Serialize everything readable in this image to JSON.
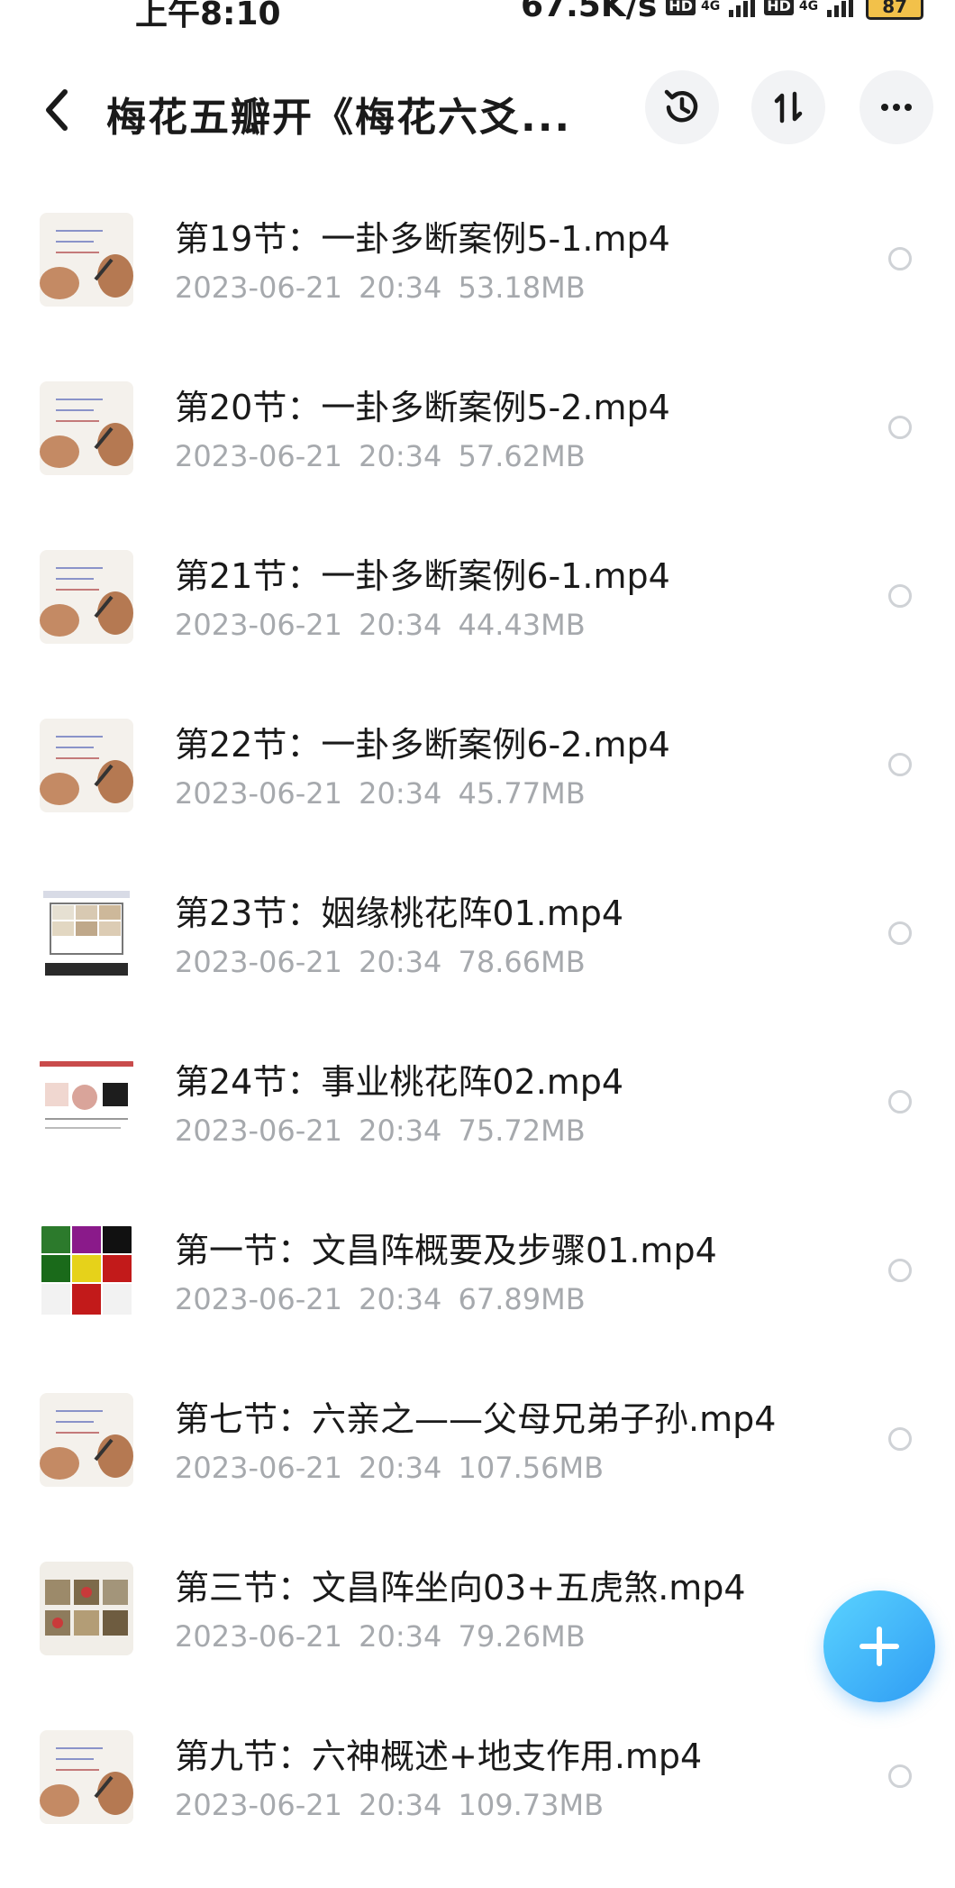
{
  "status_bar": {
    "time": "上午8:10",
    "net_speed": "67.5K/s",
    "sim1_tag": "HD",
    "sim1_type": "4G",
    "sim2_tag": "HD",
    "sim2_type": "4G",
    "battery": "87"
  },
  "header": {
    "title": "梅花五瓣开《梅花六爻...",
    "icons": [
      "back-icon",
      "history-icon",
      "sort-icon",
      "more-icon"
    ]
  },
  "files": [
    {
      "name": "第19节：一卦多断案例5-1.mp4",
      "date": "2023-06-21",
      "time": "20:34",
      "size": "53.18MB",
      "thumb_style": "handwriting"
    },
    {
      "name": "第20节：一卦多断案例5-2.mp4",
      "date": "2023-06-21",
      "time": "20:34",
      "size": "57.62MB",
      "thumb_style": "handwriting"
    },
    {
      "name": "第21节：一卦多断案例6-1.mp4",
      "date": "2023-06-21",
      "time": "20:34",
      "size": "44.43MB",
      "thumb_style": "handwriting"
    },
    {
      "name": "第22节：一卦多断案例6-2.mp4",
      "date": "2023-06-21",
      "time": "20:34",
      "size": "45.77MB",
      "thumb_style": "handwriting"
    },
    {
      "name": "第23节：姻缘桃花阵01.mp4",
      "date": "2023-06-21",
      "time": "20:34",
      "size": "78.66MB",
      "thumb_style": "grid"
    },
    {
      "name": "第24节：事业桃花阵02.mp4",
      "date": "2023-06-21",
      "time": "20:34",
      "size": "75.72MB",
      "thumb_style": "webpage"
    },
    {
      "name": "第一节：文昌阵概要及步骤01.mp4",
      "date": "2023-06-21",
      "time": "20:34",
      "size": "67.89MB",
      "thumb_style": "colorgrid"
    },
    {
      "name": "第七节：六亲之——父母兄弟子孙.mp4",
      "date": "2023-06-21",
      "time": "20:34",
      "size": "107.56MB",
      "thumb_style": "handwriting"
    },
    {
      "name": "第三节：文昌阵坐向03+五虎煞.mp4",
      "date": "2023-06-21",
      "time": "20:34",
      "size": "79.26MB",
      "thumb_style": "photogrid"
    },
    {
      "name": "第九节：六神概述+地支作用.mp4",
      "date": "2023-06-21",
      "time": "20:34",
      "size": "109.73MB",
      "thumb_style": "handwriting"
    }
  ],
  "fab": {
    "icon": "plus-icon"
  },
  "colors": {
    "accent": "#2f9cf4",
    "meta_text": "#a6a9ad",
    "title_text": "#1a1a1a"
  }
}
